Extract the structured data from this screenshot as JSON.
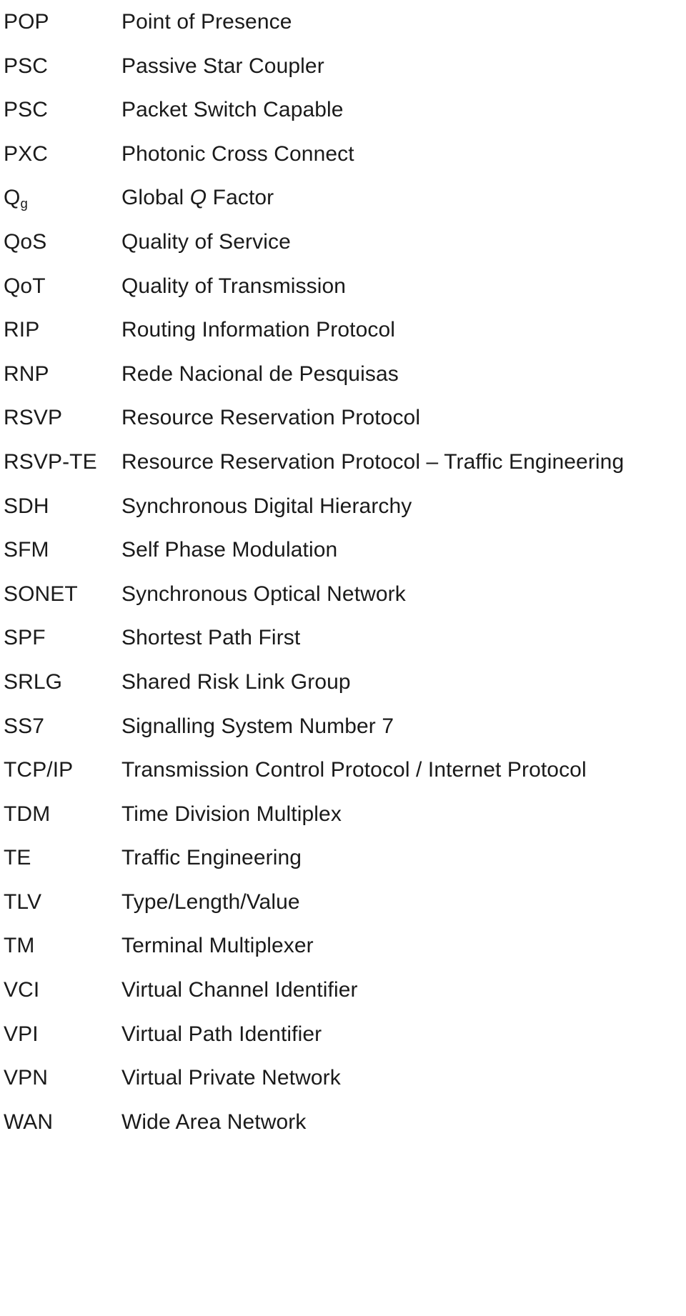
{
  "page": {
    "kind": "acronym-glossary",
    "column_headers_visible": false,
    "text_color": "#1a1a1a",
    "background_color": "#ffffff"
  },
  "glossary": {
    "entries": [
      {
        "term": "POP",
        "term_sub": "",
        "definition": "Point of Presence"
      },
      {
        "term": "PSC",
        "term_sub": "",
        "definition": "Passive Star Coupler"
      },
      {
        "term": "PSC",
        "term_sub": "",
        "definition": "Packet Switch Capable"
      },
      {
        "term": "PXC",
        "term_sub": "",
        "definition": "Photonic Cross Connect"
      },
      {
        "term": "Q",
        "term_sub": "g",
        "definition_pre": "Global ",
        "definition_italic": "Q",
        "definition_post": " Factor",
        "definition": "Global Q Factor"
      },
      {
        "term": "QoS",
        "term_sub": "",
        "definition": "Quality of Service"
      },
      {
        "term": "QoT",
        "term_sub": "",
        "definition": "Quality of Transmission"
      },
      {
        "term": "RIP",
        "term_sub": "",
        "definition": "Routing Information Protocol"
      },
      {
        "term": "RNP",
        "term_sub": "",
        "definition": "Rede Nacional de Pesquisas"
      },
      {
        "term": "RSVP",
        "term_sub": "",
        "definition": "Resource Reservation Protocol"
      },
      {
        "term": "RSVP-TE",
        "term_sub": "",
        "definition": "Resource Reservation Protocol – Traffic Engineering"
      },
      {
        "term": "SDH",
        "term_sub": "",
        "definition": "Synchronous Digital Hierarchy"
      },
      {
        "term": "SFM",
        "term_sub": "",
        "definition": "Self Phase Modulation"
      },
      {
        "term": "SONET",
        "term_sub": "",
        "definition": "Synchronous Optical Network"
      },
      {
        "term": "SPF",
        "term_sub": "",
        "definition": "Shortest Path First"
      },
      {
        "term": "SRLG",
        "term_sub": "",
        "definition": "Shared Risk Link Group"
      },
      {
        "term": "SS7",
        "term_sub": "",
        "definition": "Signalling System Number 7"
      },
      {
        "term": "TCP/IP",
        "term_sub": "",
        "definition": "Transmission Control Protocol / Internet Protocol"
      },
      {
        "term": "TDM",
        "term_sub": "",
        "definition": "Time Division Multiplex"
      },
      {
        "term": "TE",
        "term_sub": "",
        "definition": "Traffic Engineering"
      },
      {
        "term": "TLV",
        "term_sub": "",
        "definition": "Type/Length/Value"
      },
      {
        "term": "TM",
        "term_sub": "",
        "definition": "Terminal Multiplexer"
      },
      {
        "term": "VCI",
        "term_sub": "",
        "definition": "Virtual Channel Identifier"
      },
      {
        "term": "VPI",
        "term_sub": "",
        "definition": "Virtual Path Identifier"
      },
      {
        "term": "VPN",
        "term_sub": "",
        "definition": "Virtual Private Network"
      },
      {
        "term": "WAN",
        "term_sub": "",
        "definition": "Wide Area Network"
      }
    ]
  }
}
